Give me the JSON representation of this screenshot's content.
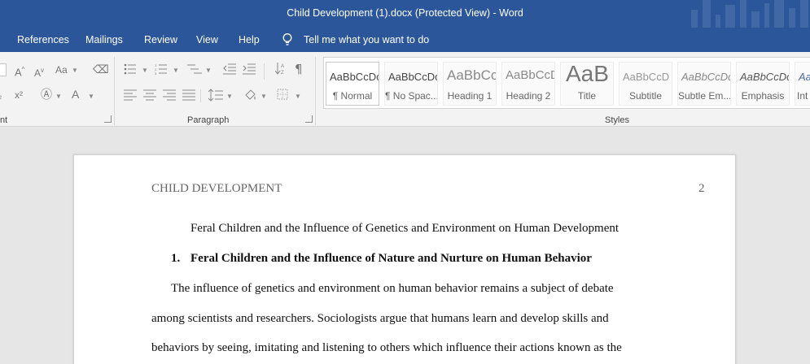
{
  "window": {
    "title": "Child Development (1).docx (Protected View)  -  Word"
  },
  "menu": {
    "tabs": [
      "References",
      "Mailings",
      "Review",
      "View",
      "Help"
    ],
    "tell_me": "Tell me what you want to do"
  },
  "ribbon": {
    "groups": {
      "font_partial": "nt",
      "paragraph": "Paragraph",
      "styles": "Styles"
    },
    "style_gallery": [
      {
        "preview": "AaBbCcDc",
        "name": "¶ Normal"
      },
      {
        "preview": "AaBbCcDc",
        "name": "¶ No Spac..."
      },
      {
        "preview": "AaBbCc",
        "name": "Heading 1"
      },
      {
        "preview": "AaBbCcD",
        "name": "Heading 2"
      },
      {
        "preview": "AaB",
        "name": "Title"
      },
      {
        "preview": "AaBbCcD",
        "name": "Subtitle"
      },
      {
        "preview": "AaBbCcDc",
        "name": "Subtle Em..."
      },
      {
        "preview": "AaBbCcDc",
        "name": "Emphasis"
      },
      {
        "preview": "AaBbCcDc",
        "name": "Int"
      }
    ]
  },
  "document": {
    "running_head": "CHILD DEVELOPMENT",
    "page_number": "2",
    "title": "Feral Children and the Influence of Genetics and Environment on Human Development",
    "heading1_number": "1.",
    "heading1_text": "Feral Children and the Influence of Nature and Nurture on Human Behavior",
    "body_lines": [
      "The influence of genetics and environment on human behavior remains a subject of debate",
      "among scientists and researchers. Sociologists argue that humans learn and develop skills and",
      "behaviors by seeing, imitating and listening to others which influence their actions known as the"
    ]
  },
  "colors": {
    "brand_blue": "#2b579a",
    "ribbon_bg": "#f3f3f3",
    "canvas_bg": "#e6e6e6"
  }
}
